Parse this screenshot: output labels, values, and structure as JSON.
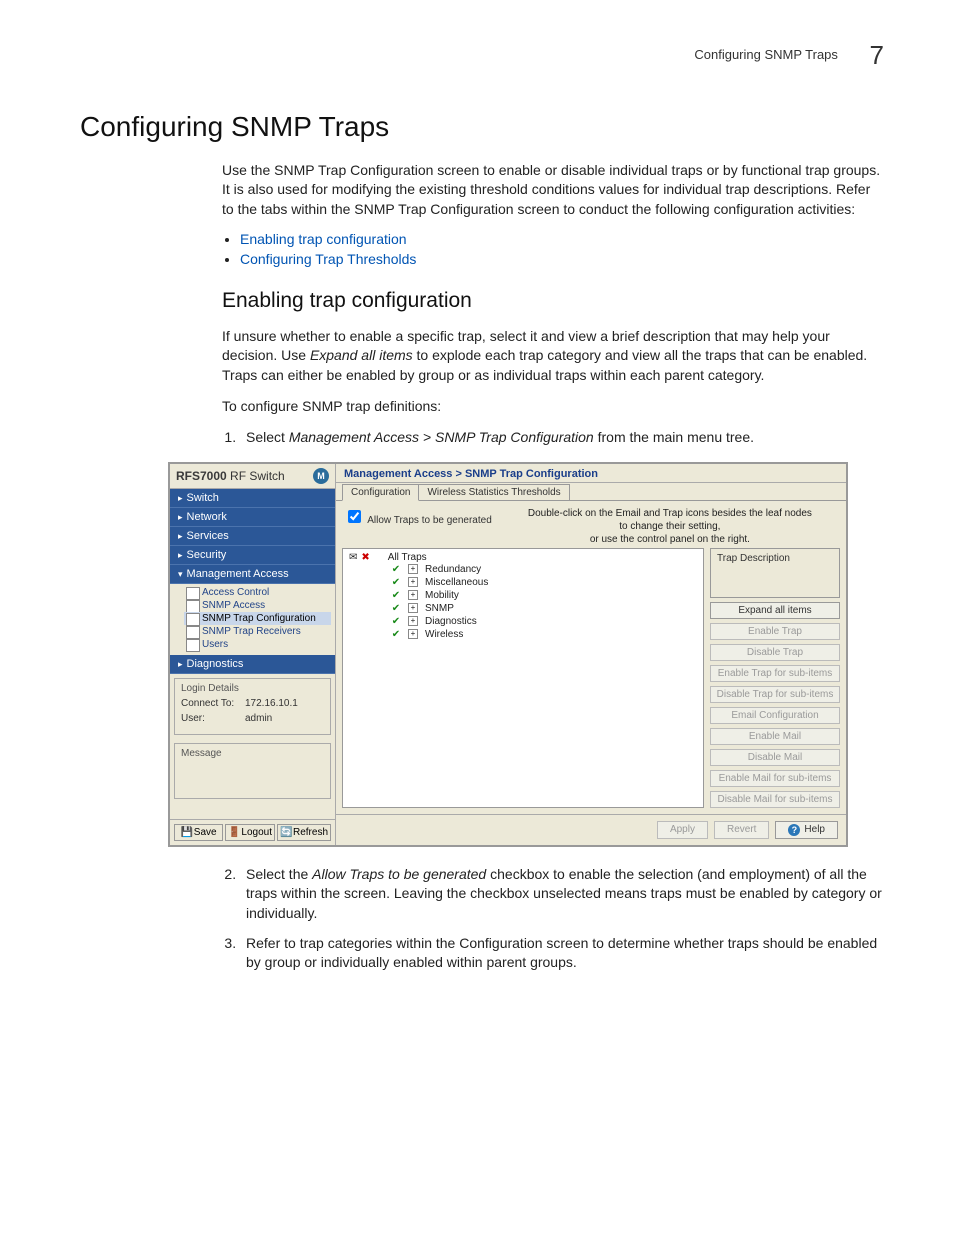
{
  "header": {
    "running_title": "Configuring SNMP Traps",
    "chapter_number": "7"
  },
  "h1": "Configuring SNMP Traps",
  "intro": "Use the SNMP Trap Configuration screen to enable or disable individual traps or by functional trap groups. It is also used for modifying the existing threshold conditions values for individual trap descriptions. Refer to the tabs within the SNMP Trap Configuration screen to conduct the following configuration activities:",
  "links": {
    "a": "Enabling trap configuration",
    "b": "Configuring Trap Thresholds"
  },
  "h2": "Enabling trap configuration",
  "para2": "If unsure whether to enable a specific trap, select it and view a brief description that may help your decision. Use ",
  "para2_em": "Expand all items",
  "para2_b": " to explode each trap category and view all the traps that can be enabled. Traps can either be enabled by group or as individual traps within each parent category.",
  "para3": "To configure SNMP trap definitions:",
  "step1a": "Select ",
  "step1em": "Management Access > SNMP Trap Configuration",
  "step1b": " from the main menu tree.",
  "step2a": "Select the ",
  "step2em": "Allow Traps to be generated",
  "step2b": " checkbox to enable the selection (and employment) of all the traps within the screen. Leaving the checkbox unselected means traps must be enabled by category or individually.",
  "step3": "Refer to trap categories within the Configuration screen to determine whether traps should be enabled by group or individually enabled within parent groups.",
  "ui": {
    "sidebar_title_a": "RFS7000",
    "sidebar_title_b": " RF Switch",
    "logo": "M",
    "nav": {
      "switch": "Switch",
      "network": "Network",
      "services": "Services",
      "security": "Security",
      "mgmt": "Management Access",
      "sub": {
        "access": "Access Control",
        "snmp_access": "SNMP Access",
        "snmp_trap_cfg": "SNMP Trap Configuration",
        "snmp_trap_rx": "SNMP Trap Receivers",
        "users": "Users"
      },
      "diag": "Diagnostics"
    },
    "login": {
      "legend": "Login Details",
      "connect_lbl": "Connect To:",
      "connect_val": "172.16.10.1",
      "user_lbl": "User:",
      "user_val": "admin"
    },
    "message_legend": "Message",
    "footer": {
      "save": "Save",
      "logout": "Logout",
      "refresh": "Refresh"
    },
    "crumb": "Management Access > SNMP Trap Configuration",
    "tabs": {
      "a": "Configuration",
      "b": "Wireless Statistics Thresholds"
    },
    "allow": "Allow Traps to be generated",
    "hint1": "Double-click on the Email and Trap icons besides the leaf nodes",
    "hint2": "to change their setting,",
    "hint3": "or use the control panel on the right.",
    "tree": {
      "root": "All Traps",
      "nodes": [
        "Redundancy",
        "Miscellaneous",
        "Mobility",
        "SNMP",
        "Diagnostics",
        "Wireless"
      ]
    },
    "desc_title": "Trap Description",
    "buttons": {
      "expand": "Expand all items",
      "enable_trap": "Enable Trap",
      "disable_trap": "Disable Trap",
      "en_sub": "Enable Trap for sub-items",
      "dis_sub": "Disable Trap for sub-items",
      "email_cfg": "Email Configuration",
      "enable_mail": "Enable Mail",
      "disable_mail": "Disable Mail",
      "en_mail_sub": "Enable Mail for sub-items",
      "dis_mail_sub": "Disable Mail for sub-items"
    },
    "foot": {
      "apply": "Apply",
      "revert": "Revert",
      "help": "Help"
    }
  }
}
